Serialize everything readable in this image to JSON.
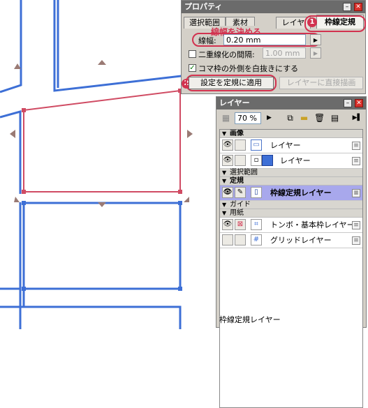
{
  "property_panel": {
    "title": "プロパティ",
    "tabs": [
      "選択範囲",
      "素材",
      "レイヤ",
      "枠線定規"
    ],
    "width_label": "線幅:",
    "width_value": "0.20 mm",
    "double_line_label": "二重線化の間隔:",
    "double_line_value": "1.00 mm",
    "fill_white_label": "コマ枠の外側を白抜きにする",
    "apply_button": "設定を定規に適用",
    "direct_draw_button": "レイヤーに直接描画",
    "annotation_1_number": "1",
    "annotation_2_number": "2",
    "annotation_width_text": "線幅を決める"
  },
  "layer_panel": {
    "title": "レイヤー",
    "zoom": "70 %",
    "groups": [
      {
        "label": "画像"
      },
      {
        "label": "選択範囲"
      },
      {
        "label": "定規"
      },
      {
        "label": "ガイド"
      },
      {
        "label": "用紙"
      }
    ],
    "layers": [
      {
        "name": "レイヤー"
      },
      {
        "name": "レイヤー"
      },
      {
        "name": "枠線定規レイヤー"
      },
      {
        "name": "トンボ・基本枠レイヤー"
      },
      {
        "name": "グリッドレイヤー"
      }
    ],
    "status": "枠線定規レイヤー"
  },
  "colors": {
    "annotation": "#d2324f",
    "frame_blue": "#3d6fd6",
    "frame_selected": "#d04b63",
    "selected_row": "#a8a8ec"
  }
}
